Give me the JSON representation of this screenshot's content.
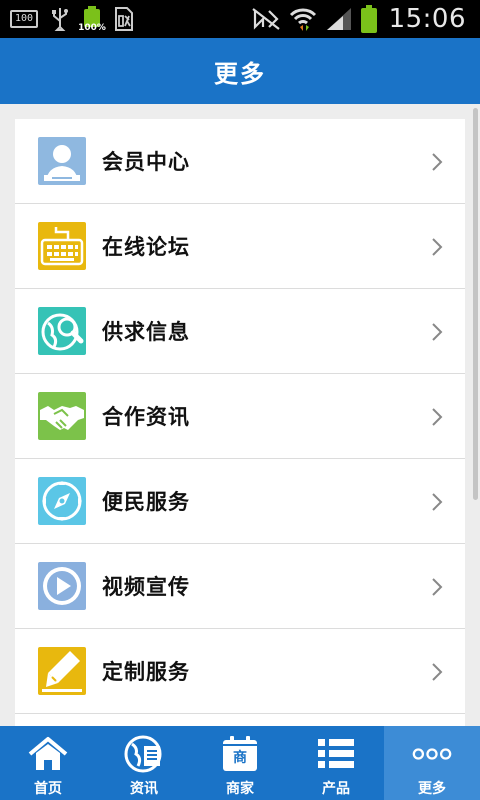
{
  "status_bar": {
    "left_box_text": "100",
    "battery_small_text": "100%",
    "time": "15:06"
  },
  "header": {
    "title": "更多"
  },
  "menu": {
    "items": [
      {
        "label": "会员中心",
        "icon": "member-icon",
        "color": "#8fb8e0"
      },
      {
        "label": "在线论坛",
        "icon": "forum-icon",
        "color": "#e8b80e"
      },
      {
        "label": "供求信息",
        "icon": "supply-demand-icon",
        "color": "#35c3b6"
      },
      {
        "label": "合作资讯",
        "icon": "handshake-icon",
        "color": "#7cc24a"
      },
      {
        "label": "便民服务",
        "icon": "compass-icon",
        "color": "#5bc6e6"
      },
      {
        "label": "视频宣传",
        "icon": "video-icon",
        "color": "#8ab0de"
      },
      {
        "label": "定制服务",
        "icon": "pen-icon",
        "color": "#e8b80e"
      }
    ]
  },
  "bottom_nav": {
    "items": [
      {
        "label": "首页",
        "icon": "home-icon"
      },
      {
        "label": "资讯",
        "icon": "globe-news-icon"
      },
      {
        "label": "商家",
        "icon": "merchant-calendar-icon",
        "badge": "商"
      },
      {
        "label": "产品",
        "icon": "list-icon"
      },
      {
        "label": "更多",
        "icon": "more-dots-icon",
        "active": true
      }
    ]
  },
  "colors": {
    "primary": "#1a73c7",
    "active_tab": "#3d8cd6",
    "background": "#ededed"
  }
}
